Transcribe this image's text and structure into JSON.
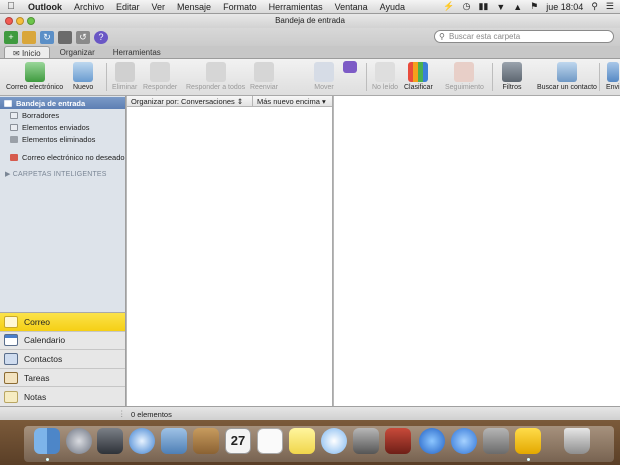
{
  "menubar": {
    "items": [
      "Outlook",
      "Archivo",
      "Editar",
      "Ver",
      "Mensaje",
      "Formato",
      "Herramientas",
      "Ventana",
      "Ayuda"
    ],
    "clock": "jue 18:04",
    "icons": [
      "apple-icon",
      "bolt-icon",
      "clock-icon",
      "battery-icon",
      "wifi-icon",
      "volume-icon",
      "flag-icon",
      "search-icon"
    ]
  },
  "window": {
    "title": "Bandeja de entrada"
  },
  "quickbar": {
    "search_placeholder": "Buscar esta carpeta"
  },
  "ribbon": {
    "tabs": [
      "Inicio",
      "Organizar",
      "Herramientas"
    ],
    "buttons": {
      "email": "Correo electrónico",
      "new": "Nuevo",
      "delete": "Eliminar",
      "reply": "Responder",
      "reply_all": "Responder a todos",
      "forward": "Reenviar",
      "move": "Mover",
      "unread": "No leído",
      "categorize": "Clasificar",
      "followup": "Seguimiento",
      "filters": "Filtros",
      "find_contact": "Buscar un contacto",
      "send_receive": "Envi"
    }
  },
  "folders": {
    "items": [
      "Bandeja de entrada",
      "Borradores",
      "Elementos enviados",
      "Elementos eliminados"
    ],
    "junk": "Correo electrónico no deseado",
    "smart_header": "CARPETAS INTELIGENTES"
  },
  "nav": {
    "sections": [
      "Correo",
      "Calendario",
      "Contactos",
      "Tareas",
      "Notas"
    ]
  },
  "list": {
    "sort_by": "Organizar por: Conversaciones",
    "order": "Más nuevo encima"
  },
  "status": {
    "count": "0 elementos"
  },
  "dock": {
    "calendar_day": "27",
    "apps": [
      "finder-icon",
      "launchpad-icon",
      "mission-control-icon",
      "safari-icon",
      "mail-icon",
      "contacts-icon",
      "calendar-icon",
      "reminders-icon",
      "notes-icon",
      "messages-icon",
      "facetime-icon",
      "photo-booth-icon",
      "itunes-icon",
      "app-store-icon",
      "system-preferences-icon",
      "outlook-icon",
      "trash-icon"
    ]
  },
  "colors": {
    "accent_yellow": "#f5cf14",
    "selection_blue": "#5d7fb3"
  }
}
